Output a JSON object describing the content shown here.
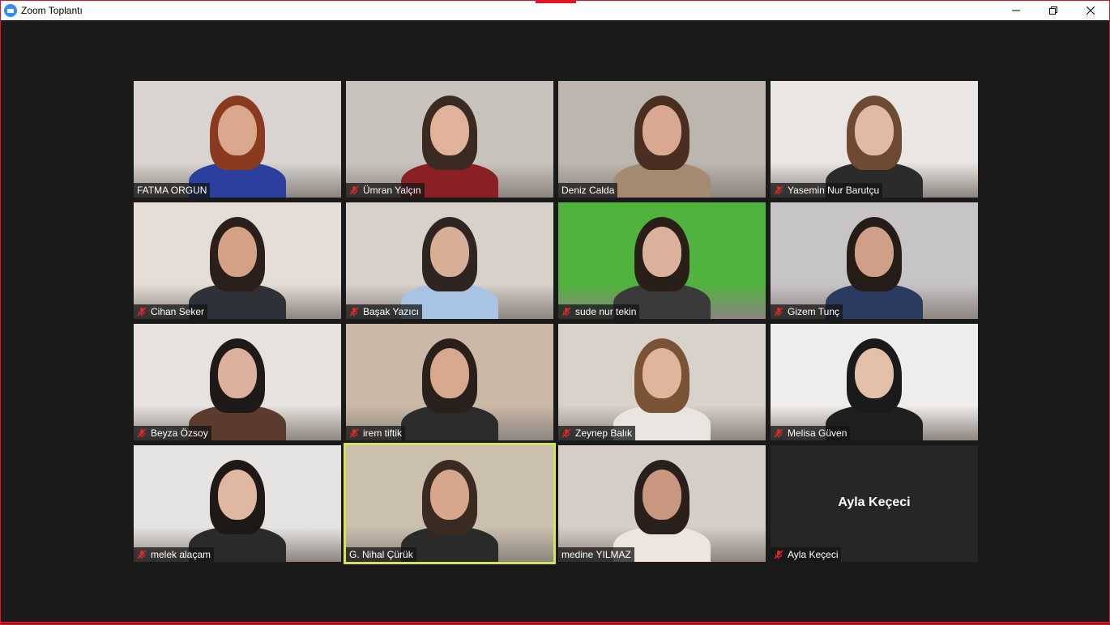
{
  "window": {
    "title": "Zoom Toplantı"
  },
  "colors": {
    "active_speaker": "#d6e25a",
    "muted": "#e02828",
    "stage": "#1a1a1a"
  },
  "participants": [
    {
      "name": "FATMA ORGUN",
      "muted": false,
      "bg": "#d9d4cf",
      "skin": "#d9a78c",
      "hair": "#8a3b1f",
      "shirt": "#2a3f9e"
    },
    {
      "name": "Ümran Yalçın",
      "muted": true,
      "bg": "#c9c3bd",
      "skin": "#e0b29a",
      "hair": "#3b2a22",
      "shirt": "#8a1f26"
    },
    {
      "name": "Deniz Calda",
      "muted": false,
      "bg": "#bdb6ae",
      "skin": "#d8a890",
      "hair": "#4a2e22",
      "shirt": "#a58a72"
    },
    {
      "name": "Yasemin Nur Barutçu",
      "muted": true,
      "bg": "#e9e6e3",
      "skin": "#e2b9a2",
      "hair": "#6e4a32",
      "shirt": "#2b2b2b"
    },
    {
      "name": "Cihan Seker",
      "muted": true,
      "bg": "#e6ded6",
      "skin": "#d4a184",
      "hair": "#2a1f1a",
      "shirt": "#2e3238"
    },
    {
      "name": "Başak Yazıcı",
      "muted": true,
      "bg": "#d7d1ca",
      "skin": "#d9ae96",
      "hair": "#2e2420",
      "shirt": "#a9c3e4"
    },
    {
      "name": "sude nur tekin",
      "muted": true,
      "bg": "#4fb33c",
      "skin": "#dcb09a",
      "hair": "#2a1e18",
      "shirt": "#3a3a3a"
    },
    {
      "name": "Gizem Tunç",
      "muted": true,
      "bg": "#c7c4c6",
      "skin": "#cf9f87",
      "hair": "#251c18",
      "shirt": "#2b3a60"
    },
    {
      "name": "Beyza Özsoy",
      "muted": true,
      "bg": "#e7e2de",
      "skin": "#dcb09c",
      "hair": "#1e1a1a",
      "shirt": "#5a3b2d"
    },
    {
      "name": "irem tiftik",
      "muted": true,
      "bg": "#cbb8a6",
      "skin": "#d7a78e",
      "hair": "#2a201b",
      "shirt": "#2c2c2c"
    },
    {
      "name": "Zeynep Balık",
      "muted": true,
      "bg": "#d9d2cb",
      "skin": "#e0b59c",
      "hair": "#7a5236",
      "shirt": "#e8e4e0"
    },
    {
      "name": "Melisa Güven",
      "muted": true,
      "bg": "#efedeb",
      "skin": "#e3bfa8",
      "hair": "#1a1a1a",
      "shirt": "#1f1f1f"
    },
    {
      "name": "melek alaçam",
      "muted": true,
      "bg": "#e6e4e2",
      "skin": "#e0b8a2",
      "hair": "#1e1816",
      "shirt": "#2a2a2a"
    },
    {
      "name": "G. Nihal Çürük",
      "muted": false,
      "bg": "#cbbfae",
      "skin": "#d6a78d",
      "hair": "#3a2a22",
      "shirt": "#2a2a2a"
    },
    {
      "name": "medine YILMAZ",
      "muted": false,
      "bg": "#d6cfc7",
      "skin": "#c99680",
      "hair": "#2a1f1a",
      "shirt": "#ece6df"
    },
    {
      "name": "Ayla Keçeci",
      "muted": true,
      "video_off": true
    }
  ]
}
